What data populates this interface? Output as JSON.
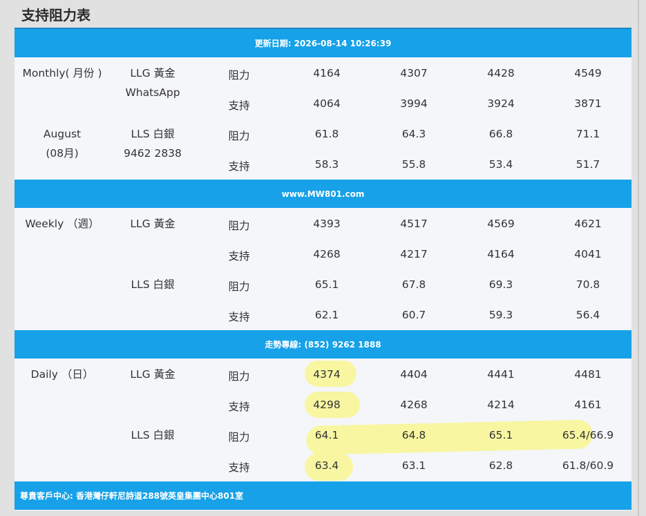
{
  "page_title": "支持阻力表",
  "bands": {
    "updated": "更新日期: 2026-08-14 10:26:39",
    "website": "www.MW801.com",
    "hotline": "走勢專線: (852) 9262 1888",
    "address": "尊貴客戶中心: 香港灣仔軒尼詩道288號英皇集團中心801室"
  },
  "labels": {
    "resistance": "阻力",
    "support": "支持"
  },
  "monthly": {
    "period": "Monthly( 月份 )",
    "month": "August",
    "month_zh": "(08月)",
    "gold": "LLG 黃金",
    "whatsapp": "WhatsApp",
    "silver": "LLS 白銀",
    "phone": "9462 2838",
    "gold_resistance": [
      "4164",
      "4307",
      "4428",
      "4549"
    ],
    "gold_support": [
      "4064",
      "3994",
      "3924",
      "3871"
    ],
    "silver_resistance": [
      "61.8",
      "64.3",
      "66.8",
      "71.1"
    ],
    "silver_support": [
      "58.3",
      "55.8",
      "53.4",
      "51.7"
    ]
  },
  "weekly": {
    "period": "Weekly （週）",
    "gold": "LLG 黃金",
    "silver": "LLS 白銀",
    "gold_resistance": [
      "4393",
      "4517",
      "4569",
      "4621"
    ],
    "gold_support": [
      "4268",
      "4217",
      "4164",
      "4041"
    ],
    "silver_resistance": [
      "65.1",
      "67.8",
      "69.3",
      "70.8"
    ],
    "silver_support": [
      "62.1",
      "60.7",
      "59.3",
      "56.4"
    ]
  },
  "daily": {
    "period": "Daily （日）",
    "gold": "LLG 黃金",
    "silver": "LLS 白銀",
    "gold_resistance": [
      "4374",
      "4404",
      "4441",
      "4481"
    ],
    "gold_support": [
      "4298",
      "4268",
      "4214",
      "4161"
    ],
    "silver_resistance": [
      "64.1",
      "64.8",
      "65.1",
      "65.4/66.9"
    ],
    "silver_support": [
      "63.4",
      "63.1",
      "62.8",
      "61.8/60.9"
    ]
  },
  "colors": {
    "band": "#16a1e8",
    "highlight": "#f8f6a1",
    "card": "#f4f6fa"
  }
}
